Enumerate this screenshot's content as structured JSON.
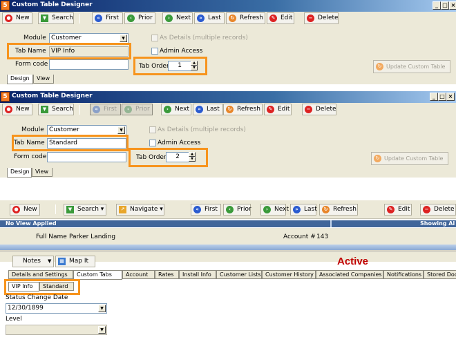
{
  "colors": {
    "highlight": "#f7941d",
    "titlebar": "#0a246a",
    "active_status": "#c00000",
    "view_bar": "#40659a"
  },
  "window1": {
    "title": "Custom Table Designer",
    "app_icon": "app-logo-icon",
    "toolbar": {
      "new": "New",
      "search": "Search",
      "first": "First",
      "prior": "Prior",
      "next": "Next",
      "last": "Last",
      "refresh": "Refresh",
      "edit": "Edit",
      "delete": "Delete"
    },
    "form": {
      "module_label": "Module",
      "module_value": "Customer",
      "tab_name_label": "Tab Name",
      "tab_name_value": "VIP Info",
      "form_code_label": "Form code",
      "form_code_value": "",
      "as_details_label": "As Details (multiple records)",
      "admin_access_label": "Admin Access",
      "tab_order_label": "Tab Order",
      "tab_order_value": "1",
      "update_button": "Update Custom Table"
    },
    "tabs": [
      "Design",
      "View"
    ]
  },
  "window2": {
    "title": "Custom Table Designer",
    "toolbar": {
      "new": "New",
      "search": "Search",
      "first": "First",
      "prior": "Prior",
      "next": "Next",
      "last": "Last",
      "refresh": "Refresh",
      "edit": "Edit",
      "delete": "Delete"
    },
    "form": {
      "module_label": "Module",
      "module_value": "Customer",
      "tab_name_label": "Tab Name",
      "tab_name_value": "Standard",
      "form_code_label": "Form code",
      "form_code_value": "",
      "as_details_label": "As Details (multiple records)",
      "admin_access_label": "Admin Access",
      "tab_order_label": "Tab Order",
      "tab_order_value": "2",
      "update_button": "Update Custom Table"
    },
    "tabs": [
      "Design",
      "View"
    ]
  },
  "customer": {
    "toolbar": {
      "new": "New",
      "search": "Search",
      "navigate": "Navigate",
      "first": "First",
      "prior": "Prior",
      "next": "Next",
      "last": "Last",
      "refresh": "Refresh",
      "edit": "Edit",
      "delete": "Delete"
    },
    "view_bar_left": "No View Applied",
    "view_bar_right": "Showing Al",
    "full_name_label": "Full Name",
    "full_name_value": "Parker Landing",
    "account_label": "Account #",
    "account_value": "143",
    "notes_label": "Notes",
    "map_it_label": "Map It",
    "status": "Active",
    "tabs": [
      "Details and Settings",
      "Custom Tabs",
      "Account",
      "Rates",
      "Install Info",
      "Customer Lists",
      "Customer History",
      "Associated Companies",
      "Notifications",
      "Stored Docu"
    ],
    "subtabs": [
      "VIP Info",
      "Standard"
    ],
    "status_change_date_label": "Status Change Date",
    "status_change_date_value": "12/30/1899",
    "level_label": "Level",
    "level_value": ""
  }
}
